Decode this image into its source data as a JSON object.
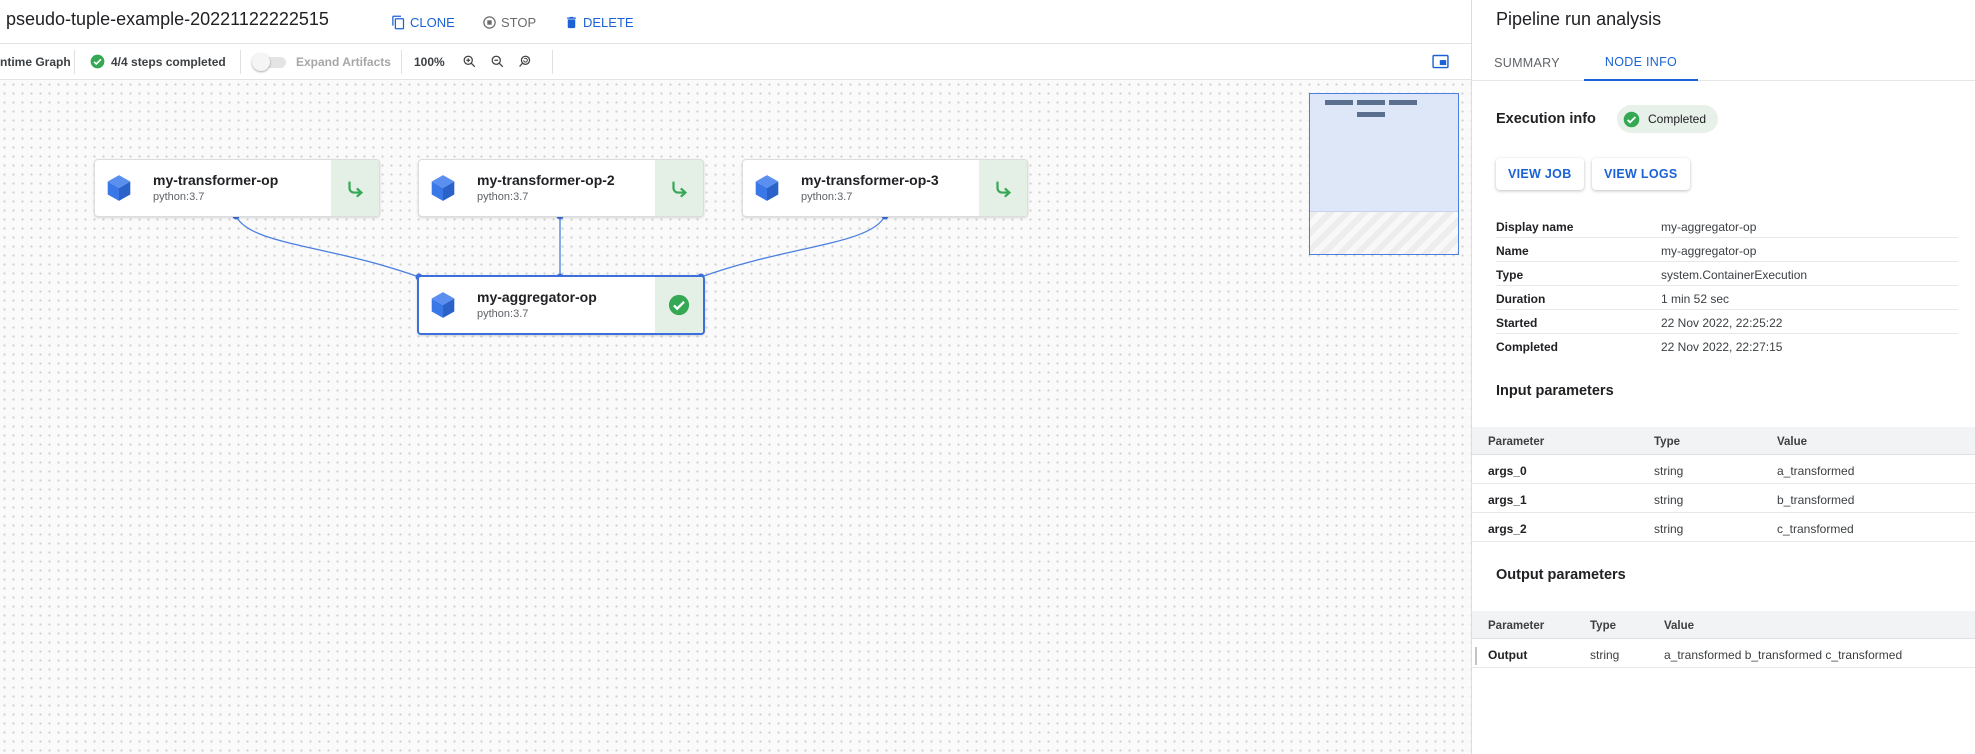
{
  "header": {
    "run_title": "pseudo-tuple-example-20221122222515",
    "actions": {
      "clone": "CLONE",
      "stop": "STOP",
      "delete": "DELETE"
    }
  },
  "toolbar": {
    "graph_tab": "ntime Graph",
    "steps_completed": "4/4 steps completed",
    "expand_artifacts": "Expand Artifacts",
    "expand_artifacts_on": false,
    "zoom_level": "100%"
  },
  "graph": {
    "nodes": [
      {
        "name": "my-transformer-op",
        "image": "python:3.7",
        "status_icon": "cache-reuse-icon"
      },
      {
        "name": "my-transformer-op-2",
        "image": "python:3.7",
        "status_icon": "cache-reuse-icon"
      },
      {
        "name": "my-transformer-op-3",
        "image": "python:3.7",
        "status_icon": "cache-reuse-icon"
      },
      {
        "name": "my-aggregator-op",
        "image": "python:3.7",
        "status_icon": "check-circle-icon",
        "selected": true
      }
    ]
  },
  "panel": {
    "title": "Pipeline run analysis",
    "tabs": [
      "SUMMARY",
      "NODE INFO"
    ],
    "active_tab": "NODE INFO",
    "execution_info": {
      "heading": "Execution info",
      "status": "Completed",
      "buttons": {
        "view_job": "VIEW JOB",
        "view_logs": "VIEW LOGS"
      },
      "rows": [
        {
          "key": "Display name",
          "value": "my-aggregator-op"
        },
        {
          "key": "Name",
          "value": "my-aggregator-op"
        },
        {
          "key": "Type",
          "value": "system.ContainerExecution"
        },
        {
          "key": "Duration",
          "value": "1 min 52 sec"
        },
        {
          "key": "Started",
          "value": "22 Nov 2022, 22:25:22"
        },
        {
          "key": "Completed",
          "value": "22 Nov 2022, 22:27:15"
        }
      ]
    },
    "input_parameters": {
      "heading": "Input parameters",
      "columns": [
        "Parameter",
        "Type",
        "Value"
      ],
      "rows": [
        {
          "parameter": "args_0",
          "type": "string",
          "value": "a_transformed"
        },
        {
          "parameter": "args_1",
          "type": "string",
          "value": "b_transformed"
        },
        {
          "parameter": "args_2",
          "type": "string",
          "value": "c_transformed"
        }
      ]
    },
    "output_parameters": {
      "heading": "Output parameters",
      "columns": [
        "Parameter",
        "Type",
        "Value"
      ],
      "rows": [
        {
          "parameter": "Output",
          "type": "string",
          "value": "a_transformed b_transformed c_transformed"
        }
      ]
    }
  },
  "colors": {
    "accent": "#1a62d6",
    "success": "#34a853",
    "node_icon": "#3b78e7",
    "cache_badge_bg": "#e4efe5"
  }
}
